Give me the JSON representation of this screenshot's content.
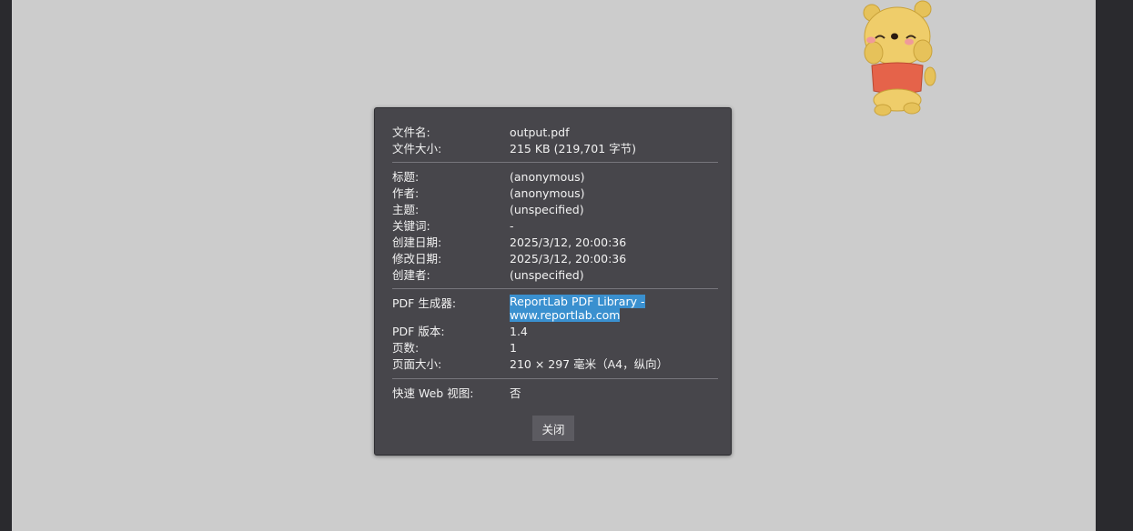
{
  "dialog": {
    "file_info": [
      {
        "label": "文件名:",
        "value": "output.pdf"
      },
      {
        "label": "文件大小:",
        "value": "215 KB (219,701 字节)"
      }
    ],
    "doc_info": [
      {
        "label": "标题:",
        "value": "(anonymous)"
      },
      {
        "label": "作者:",
        "value": "(anonymous)"
      },
      {
        "label": "主题:",
        "value": "(unspecified)"
      },
      {
        "label": "关键词:",
        "value": "-"
      },
      {
        "label": "创建日期:",
        "value": "2025/3/12, 20:00:36"
      },
      {
        "label": "修改日期:",
        "value": "2025/3/12, 20:00:36"
      },
      {
        "label": "创建者:",
        "value": "(unspecified)"
      }
    ],
    "pdf_info": {
      "producer_label": "PDF 生成器:",
      "producer_line1": "ReportLab PDF Library -",
      "producer_line2": "www.reportlab.com",
      "rows": [
        {
          "label": "PDF 版本:",
          "value": "1.4"
        },
        {
          "label": "页数:",
          "value": "1"
        },
        {
          "label": "页面大小:",
          "value": "210 × 297 毫米（A4，纵向）"
        }
      ]
    },
    "fast_web": {
      "label": "快速 Web 视图:",
      "value": "否"
    },
    "close_label": "关闭"
  },
  "mascot": {
    "icon": "winnie-the-pooh-mascot-icon"
  },
  "colors": {
    "dialog_bg": "#47464b",
    "page_bg": "#cccccc",
    "viewer_bg": "#2a2a2e",
    "selection": "#3a90cf"
  }
}
